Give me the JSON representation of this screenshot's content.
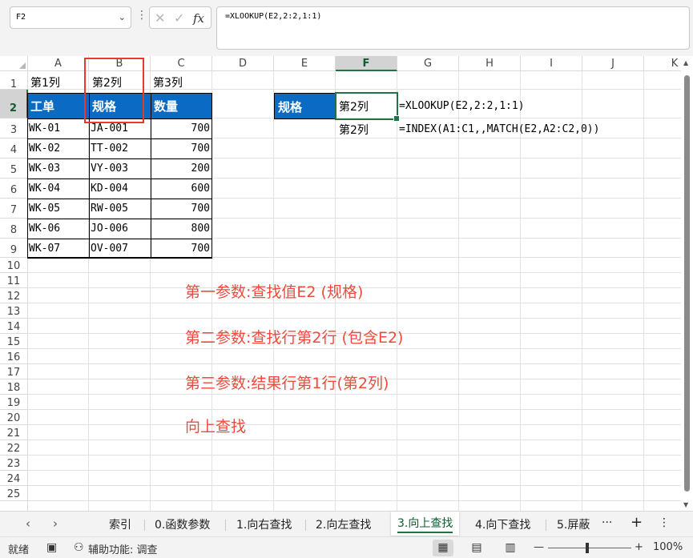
{
  "formula_bar": {
    "name_box": "F2",
    "formula": "=XLOOKUP(E2,2:2,1:1)"
  },
  "columns": [
    "A",
    "B",
    "C",
    "D",
    "E",
    "F",
    "G",
    "H",
    "I",
    "J",
    "K"
  ],
  "selected_column": "F",
  "rows": [
    "1",
    "2",
    "3",
    "4",
    "5",
    "6",
    "7",
    "8",
    "9",
    "10",
    "11",
    "12",
    "13",
    "14",
    "15",
    "16",
    "17",
    "18",
    "19",
    "20",
    "21",
    "22",
    "23",
    "24",
    "25"
  ],
  "selected_row": "2",
  "cells": {
    "A1": "第1列",
    "B1": "第2列",
    "C1": "第3列",
    "A2": "工单",
    "B2": "规格",
    "C2": "数量",
    "data": [
      {
        "a": "WK-01",
        "b": "JA-001",
        "c": "700"
      },
      {
        "a": "WK-02",
        "b": "TT-002",
        "c": "700"
      },
      {
        "a": "WK-03",
        "b": "VY-003",
        "c": "200"
      },
      {
        "a": "WK-04",
        "b": "KD-004",
        "c": "600"
      },
      {
        "a": "WK-05",
        "b": "RW-005",
        "c": "700"
      },
      {
        "a": "WK-06",
        "b": "JO-006",
        "c": "800"
      },
      {
        "a": "WK-07",
        "b": "OV-007",
        "c": "700"
      }
    ],
    "E2": "规格",
    "F2": "第2列",
    "G2": "=XLOOKUP(E2,2:2,1:1)",
    "F3": "第2列",
    "G3": "=INDEX(A1:C1,,MATCH(E2,A2:C2,0))"
  },
  "notes": [
    "第一参数:查找值E2 (规格)",
    "第二参数:查找行第2行 (包含E2)",
    "第三参数:结果行第1行(第2列)",
    "向上查找"
  ],
  "tabs": {
    "items": [
      "索引",
      "0.函数参数",
      "1.向右查找",
      "2.向左查找",
      "3.向上查找",
      "4.向下查找",
      "5.屏蔽"
    ],
    "active": "3.向上查找",
    "more": "···",
    "add": "+",
    "menu": "⋮"
  },
  "status_bar": {
    "ready": "就绪",
    "accessibility": "辅助功能: 调查",
    "zoom": "100%",
    "zoom_minus": "—",
    "zoom_plus": "+"
  },
  "colors": {
    "header_fill": "#0a6ac4",
    "highlight_red": "#e8392f",
    "note_red": "#f04a3c",
    "excel_green": "#217346"
  }
}
